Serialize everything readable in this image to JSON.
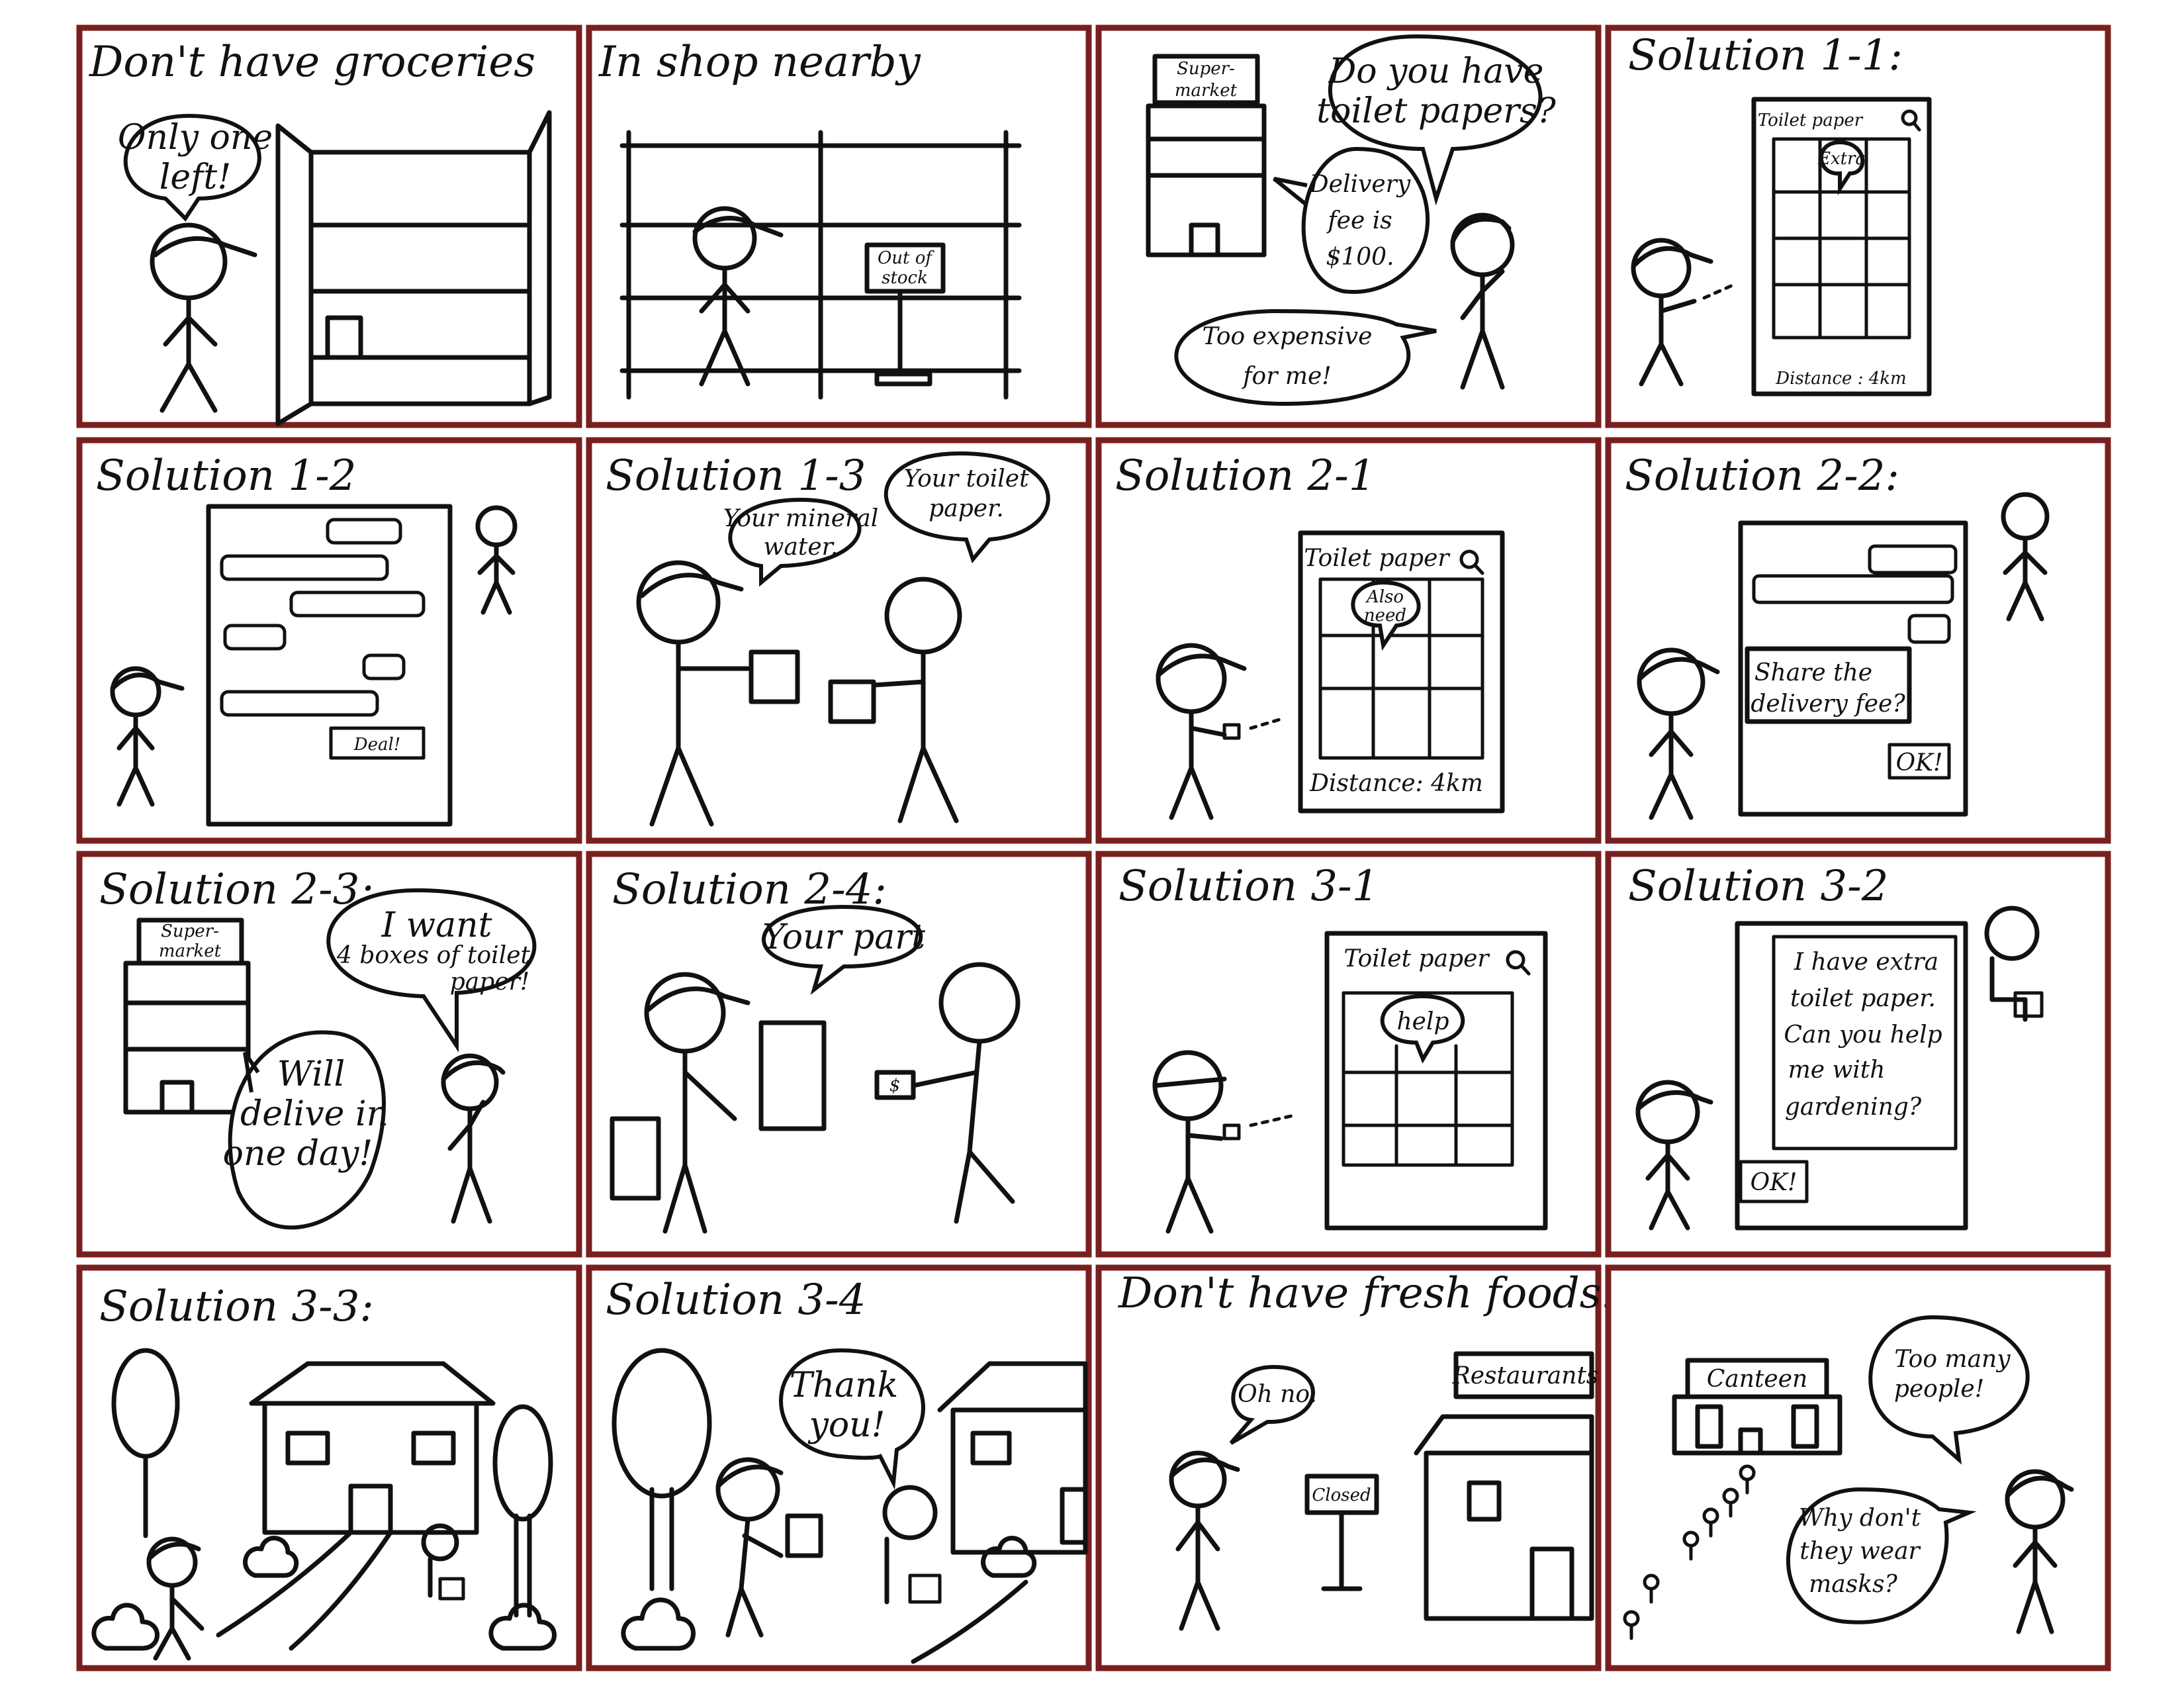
{
  "storyboard": {
    "panels": [
      {
        "title": "Don't have groceries",
        "bubbles": [
          [
            "Only one",
            "left!"
          ]
        ]
      },
      {
        "title": "In shop nearby",
        "sign": [
          "Out of",
          "stock"
        ]
      },
      {
        "title": "",
        "store_sign": [
          "Super-",
          "market"
        ],
        "bubbles": [
          [
            "Do you have",
            "toilet papers?"
          ],
          [
            "Delivery",
            "fee is",
            "$100."
          ],
          [
            "Too expensive",
            "for me!"
          ]
        ]
      },
      {
        "title": "Solution 1-1:",
        "app": {
          "search_label": "Toilet paper",
          "tag": "Extra",
          "distance": "Distance : 4km"
        }
      },
      {
        "title": "Solution 1-2",
        "deal_button": "Deal!"
      },
      {
        "title": "Solution 1-3",
        "bubbles": [
          [
            "Your mineral",
            "water."
          ],
          [
            "Your toilet",
            "paper."
          ]
        ]
      },
      {
        "title": "Solution 2-1",
        "app": {
          "search_label": "Toilet paper",
          "tag": [
            "Also",
            "need"
          ],
          "distance": "Distance: 4km"
        }
      },
      {
        "title": "Solution 2-2:",
        "message": [
          "Share the",
          "delivery fee?"
        ],
        "ok_button": "OK!"
      },
      {
        "title": "Solution 2-3:",
        "store_sign": [
          "Super-",
          "market"
        ],
        "bubbles": [
          [
            "I want",
            "4 boxes of toilet",
            "paper!"
          ],
          [
            "Will",
            "delive in",
            "one day!"
          ]
        ]
      },
      {
        "title": "Solution 2-4:",
        "bubbles": [
          [
            "Your part"
          ]
        ],
        "money_label": "$"
      },
      {
        "title": "Solution 3-1",
        "app": {
          "search_label": "Toilet paper",
          "tag": "help"
        }
      },
      {
        "title": "Solution 3-2",
        "message": [
          "I have extra",
          "toilet paper.",
          "Can you help",
          "me with",
          "gardening?"
        ],
        "ok_button": "OK!"
      },
      {
        "title": "Solution 3-3:"
      },
      {
        "title": "Solution 3-4",
        "bubbles": [
          [
            "Thank",
            "you!"
          ]
        ]
      },
      {
        "title": "Don't have fresh foods:",
        "bubbles": [
          [
            "Oh no."
          ]
        ],
        "sign": [
          "Closed"
        ],
        "store_sign": [
          "Restaurants"
        ]
      },
      {
        "title": "",
        "store_sign": [
          "Canteen"
        ],
        "bubbles": [
          [
            "Too many",
            "people!"
          ],
          [
            "Why don't",
            "they wear",
            "masks?"
          ]
        ]
      }
    ]
  }
}
